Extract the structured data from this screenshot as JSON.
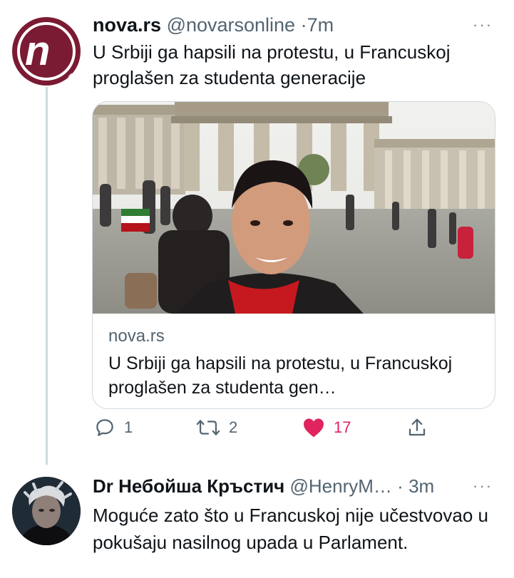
{
  "tweet1": {
    "display_name": "nova.rs",
    "handle": "@novarsonline",
    "separator": "·",
    "time": "7m",
    "more": "···",
    "text": "U Srbiji ga hapsili na protestu, u Francuskoj proglašen za studenta generacije",
    "card": {
      "domain": "nova.rs",
      "title": "U Srbiji ga hapsili na protestu, u Francuskoj proglašen za studenta gen…"
    },
    "actions": {
      "reply_count": "1",
      "retweet_count": "2",
      "like_count": "17"
    },
    "icons": [
      "reply-icon",
      "retweet-icon",
      "heart-icon",
      "share-icon"
    ],
    "like_color": "#e0245e"
  },
  "tweet2": {
    "display_name": "Dr Небойша Кръстич",
    "handle": "@HenryM…",
    "separator": "·",
    "time": "3m",
    "more": "···",
    "text": "Moguće zato što u Francuskoj nije učestvovao u pokušaju nasilnog upada u Parlament."
  }
}
